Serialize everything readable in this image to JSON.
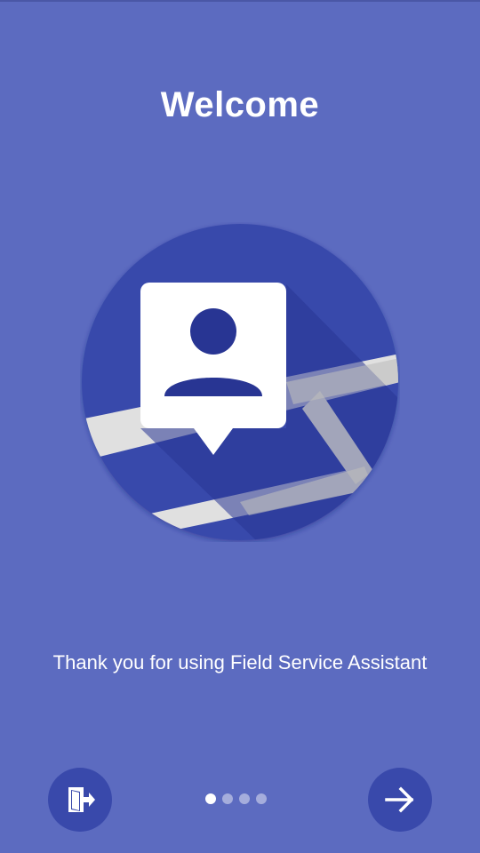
{
  "onboarding": {
    "title": "Welcome",
    "message": "Thank you for using Field Service Assistant",
    "page_indicator": {
      "total": 4,
      "current": 1
    }
  },
  "icons": {
    "hero": "contact-map-pin-icon",
    "exit": "exit-door-icon",
    "next": "arrow-right-icon"
  },
  "colors": {
    "background": "#5c6bc0",
    "accent_dark": "#3949ab",
    "text": "#ffffff"
  }
}
